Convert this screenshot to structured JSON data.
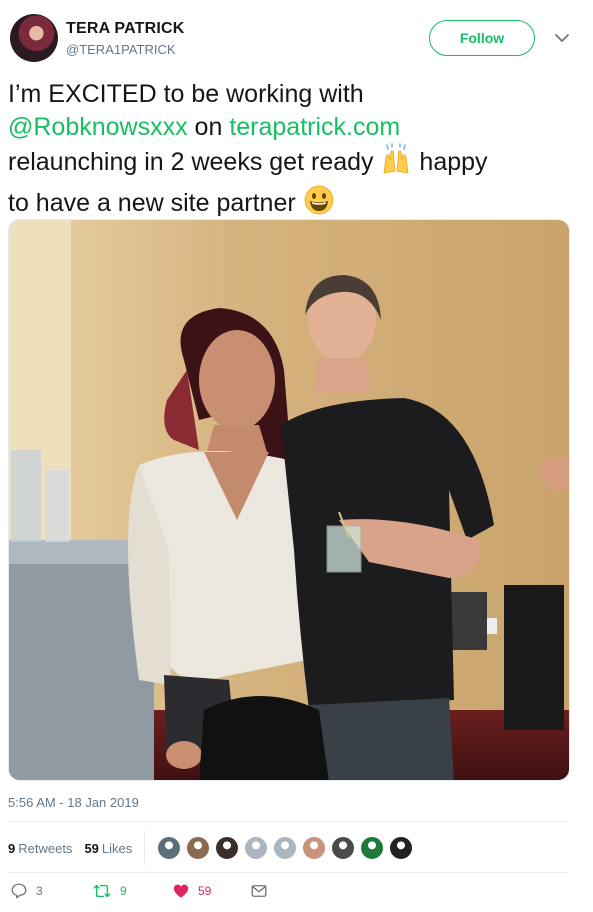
{
  "user": {
    "name": "TERA PATRICK",
    "handle": "@TERA1PATRICK"
  },
  "header": {
    "follow_label": "Follow",
    "caret_icon": "chevron-down-icon"
  },
  "tweet": {
    "line1": "I’m EXCITED to be working with",
    "mention": "@Robknowsxxx",
    "on": " on ",
    "link": "terapatrick.com",
    "line3": "relaunching in 2 weeks get ready",
    "raising_hands_emoji": "🙌",
    "line3b": " happy",
    "line4": "to have a new site partner ",
    "smile_emoji": "😃"
  },
  "photo": {
    "alt": ""
  },
  "timestamp": "5:56 AM - 18 Jan 2019",
  "stats": {
    "retweets_count": "9",
    "retweets_label": "Retweets",
    "likes_count": "59",
    "likes_label": "Likes"
  },
  "likers": [
    {
      "color": "#5a6e7c"
    },
    {
      "color": "#8b6a4f"
    },
    {
      "color": "#3a2f2a"
    },
    {
      "color": "#a9b5c0"
    },
    {
      "color": "#a9b5c0"
    },
    {
      "color": "#c9927a"
    },
    {
      "color": "#4b4b4b"
    },
    {
      "color": "#1f7a3a"
    },
    {
      "color": "#222222"
    }
  ],
  "actions": {
    "reply_count": "3",
    "retweet_count": "9",
    "like_count": "59",
    "colors": {
      "reply": "#657786",
      "retweet": "#17bf63",
      "like": "#e0245e",
      "dm": "#657786"
    }
  },
  "colors": {
    "accent": "#17bf63",
    "muted": "#657786",
    "like": "#e0245e"
  }
}
